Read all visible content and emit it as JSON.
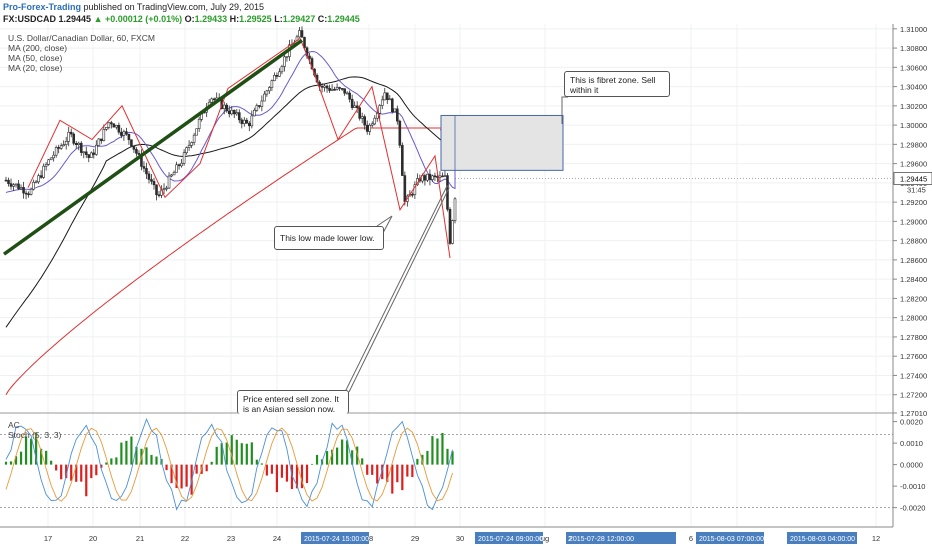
{
  "header": {
    "publisher": "Pro-Forex-Trading",
    "published_text": "published on TradingView.com, July 29, 2015",
    "symbol": "FX:USDCAD",
    "last": "1.29445",
    "change": "+0.00012 (+0.01%)",
    "o_label": "O:",
    "o": "1.29433",
    "h_label": "H:",
    "h": "1.29525",
    "l_label": "L:",
    "l": "1.29427",
    "c_label": "C:",
    "c": "1.29445"
  },
  "overlays": {
    "title": "U.S. Dollar/Canadian Dollar, 60, FXCM",
    "ma200": "MA (200, close)",
    "ma50": "MA (50, close)",
    "ma20": "MA (20, close)",
    "ac": "AC",
    "stoch": "Stoch (5, 3, 3)"
  },
  "notes": {
    "fibret": "This is fibret zone. Sell within it",
    "lowerlow": "This low made lower low.",
    "price": "Price entered sell zone. It is an Asian session now."
  },
  "colors": {
    "candle_up": "#2c2c2c",
    "candle_down": "#2c2c2c",
    "ma200": "#e03030",
    "ma50": "#1a1a1a",
    "ma20": "#6a5acd",
    "zigzag": "#e03030",
    "trendline": "#1f4f14",
    "zone_fill": "#e4e4e4",
    "zone_border": "#4466aa",
    "hist_up": "#1f8f1f",
    "hist_down": "#dd1e1e",
    "stoch_k": "#4a90d9",
    "stoch_d": "#e89a3a",
    "axis_highlight": "#4a7fbf"
  },
  "chart_data": {
    "type": "candlestick",
    "price_axis": {
      "ticks": [
        "1.31000",
        "1.30800",
        "1.30600",
        "1.30400",
        "1.30200",
        "1.30000",
        "1.29800",
        "1.29600",
        "1.29400",
        "1.29200",
        "1.29000",
        "1.28800",
        "1.28600",
        "1.28400",
        "1.28200",
        "1.28000",
        "1.27800",
        "1.27600",
        "1.27400",
        "1.27200",
        "1.27010"
      ],
      "last_price": "1.29445",
      "countdown": "31:45",
      "ylim": [
        1.2701,
        1.3105
      ]
    },
    "indicator_axis": {
      "ticks": [
        "0.0020",
        "0.0010",
        "0.0000",
        "-0.0010",
        "-0.0020"
      ],
      "ylim": [
        -0.0029,
        0.0024
      ]
    },
    "time_axis": {
      "ticks": [
        "17",
        "20",
        "21",
        "22",
        "23",
        "24",
        "28",
        "29",
        "30",
        "ug",
        "6",
        "7",
        "12"
      ],
      "highlights": [
        "2015-07-24 15:00:00",
        "2015-07-24 09:00:00",
        "2015-07-28 12:00:00",
        "2015-08-03 07:00:00",
        "2015-08-03 04:00:00"
      ],
      "highlight_extras": [
        "0",
        "2"
      ]
    },
    "ohlc_anchors": [
      {
        "time": "Jul 16",
        "price": 1.2945
      },
      {
        "time": "Jul 17",
        "price": 1.293
      },
      {
        "time": "Jul 18",
        "price": 1.2965
      },
      {
        "time": "Jul 20",
        "price": 1.299
      },
      {
        "time": "Jul 20b",
        "price": 1.2965
      },
      {
        "time": "Jul 21",
        "price": 1.3005
      },
      {
        "time": "Jul 21b",
        "price": 1.2985
      },
      {
        "time": "Jul 22",
        "price": 1.2925
      },
      {
        "time": "Jul 22b",
        "price": 1.2965
      },
      {
        "time": "Jul 23",
        "price": 1.303
      },
      {
        "time": "Jul 23b",
        "price": 1.3
      },
      {
        "time": "Jul 24",
        "price": 1.308
      },
      {
        "time": "Jul 24b",
        "price": 1.3095
      },
      {
        "time": "Jul 27",
        "price": 1.304
      },
      {
        "time": "Jul 27b",
        "price": 1.3035
      },
      {
        "time": "Jul 28",
        "price": 1.2995
      },
      {
        "time": "Jul 28b",
        "price": 1.3035
      },
      {
        "time": "Jul 28c",
        "price": 1.3005
      },
      {
        "time": "Jul 29",
        "price": 1.2918
      },
      {
        "time": "Jul 29b",
        "price": 1.2945
      },
      {
        "time": "Jul 29c",
        "price": 1.2945
      },
      {
        "time": "Jul 29d",
        "price": 1.288
      },
      {
        "time": "Jul 29e",
        "price": 1.2945
      }
    ],
    "fib_zone": {
      "price_low": 1.2953,
      "price_high": 1.301
    }
  }
}
